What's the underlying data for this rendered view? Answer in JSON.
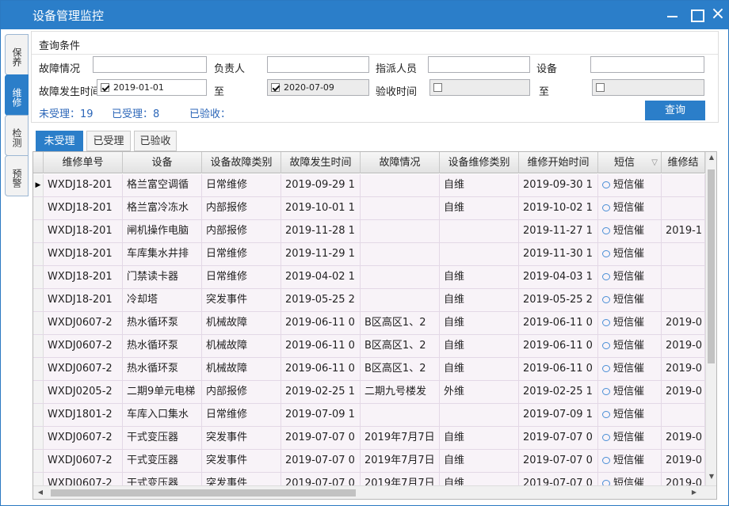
{
  "window": {
    "title": "设备管理监控"
  },
  "side_tabs": [
    {
      "label": "保养",
      "active": false
    },
    {
      "label": "维修",
      "active": true
    },
    {
      "label": "检测",
      "active": false
    },
    {
      "label": "预警",
      "active": false
    }
  ],
  "query": {
    "title": "查询条件",
    "fault_label": "故障情况",
    "fault_value": "",
    "owner_label": "负责人",
    "owner_value": "",
    "assignee_label": "指派人员",
    "assignee_value": "",
    "device_label": "设备",
    "device_value": "",
    "fault_time_label": "故障发生时间",
    "fault_time_from": "2019-01-01",
    "fault_time_to": "2020-07-09",
    "to_label": "至",
    "accept_time_label": "验收时间",
    "accept_time_from": "",
    "accept_time_to": "",
    "stat_unaccepted": "未受理：19",
    "stat_accepted": "已受理：8",
    "stat_verified": "已验收：",
    "search_button": "查询"
  },
  "tabs": [
    "未受理",
    "已受理",
    "已验收"
  ],
  "grid": {
    "columns": [
      "维修单号",
      "设备",
      "设备故障类别",
      "故障发生时间",
      "故障情况",
      "设备维修类别",
      "维修开始时间",
      "短信",
      "维修结"
    ],
    "rows": [
      [
        "WXDJ18-201",
        "格兰富空调循",
        "日常维修",
        "2019-09-29 1",
        "",
        "自维",
        "2019-09-30 1",
        "短信催",
        ""
      ],
      [
        "WXDJ18-201",
        "格兰富冷冻水",
        "内部报修",
        "2019-10-01 1",
        "",
        "自维",
        "2019-10-02 1",
        "短信催",
        ""
      ],
      [
        "WXDJ18-201",
        "闸机操作电脑",
        "内部报修",
        "2019-11-28 1",
        "",
        "",
        "2019-11-27 1",
        "短信催",
        "2019-1"
      ],
      [
        "WXDJ18-201",
        "车库集水井排",
        "日常维修",
        "2019-11-29 1",
        "",
        "",
        "2019-11-30 1",
        "短信催",
        ""
      ],
      [
        "WXDJ18-201",
        "门禁读卡器",
        "日常维修",
        "2019-04-02 1",
        "",
        "自维",
        "2019-04-03 1",
        "短信催",
        ""
      ],
      [
        "WXDJ18-201",
        "冷却塔",
        "突发事件",
        "2019-05-25 2",
        "",
        "自维",
        "2019-05-25 2",
        "短信催",
        ""
      ],
      [
        "WXDJ0607-2",
        "热水循环泵",
        "机械故障",
        "2019-06-11 0",
        "B区高区1、2",
        "自维",
        "2019-06-11 0",
        "短信催",
        "2019-0"
      ],
      [
        "WXDJ0607-2",
        "热水循环泵",
        "机械故障",
        "2019-06-11 0",
        "B区高区1、2",
        "自维",
        "2019-06-11 0",
        "短信催",
        "2019-0"
      ],
      [
        "WXDJ0607-2",
        "热水循环泵",
        "机械故障",
        "2019-06-11 0",
        "B区高区1、2",
        "自维",
        "2019-06-11 0",
        "短信催",
        "2019-0"
      ],
      [
        "WXDJ0205-2",
        "二期9单元电梯",
        "内部报修",
        "2019-02-25 1",
        "二期九号楼发",
        "外维",
        "2019-02-25 1",
        "短信催",
        "2019-0"
      ],
      [
        "WXDJ1801-2",
        "车库入口集水",
        "日常维修",
        "2019-07-09 1",
        "",
        "",
        "2019-07-09 1",
        "短信催",
        ""
      ],
      [
        "WXDJ0607-2",
        "干式变压器",
        "突发事件",
        "2019-07-07 0",
        "2019年7月7日",
        "自维",
        "2019-07-07 0",
        "短信催",
        "2019-0"
      ],
      [
        "WXDJ0607-2",
        "干式变压器",
        "突发事件",
        "2019-07-07 0",
        "2019年7月7日",
        "自维",
        "2019-07-07 0",
        "短信催",
        "2019-0"
      ],
      [
        "WXDJ0607-2",
        "干式变压器",
        "突发事件",
        "2019-07-07 0",
        "2019年7月7日",
        "自维",
        "2019-07-07 0",
        "短信催",
        "2019-0"
      ]
    ],
    "selected_row": 0
  },
  "colors": {
    "accent": "#2b7ec9",
    "row_bg": "#f8f3f8",
    "stat_text": "#2b66b8"
  }
}
